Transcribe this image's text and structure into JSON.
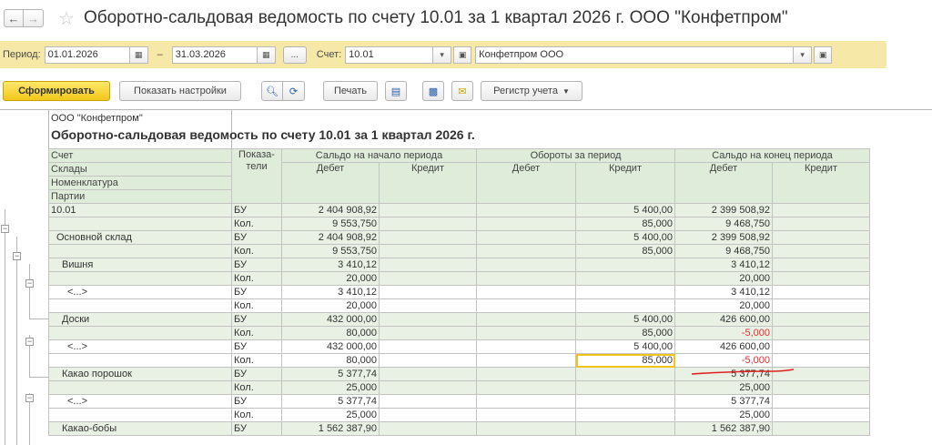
{
  "window": {
    "title": "Оборотно-сальдовая ведомость по счету 10.01 за 1 квартал 2026 г. ООО \"Конфетпром\"",
    "back_icon": "arrow-left-icon",
    "forward_icon": "arrow-right-icon",
    "favorite_icon": "star-icon"
  },
  "params": {
    "period_label": "Период:",
    "date_from": "01.01.2026",
    "dash": "–",
    "date_to": "31.03.2026",
    "more_label": "...",
    "account_label": "Счет:",
    "account_value": "10.01",
    "organization_value": "Конфетпром ООО"
  },
  "toolbar": {
    "generate_label": "Сформировать",
    "settings_label": "Показать настройки",
    "print_label": "Печать",
    "register_label": "Регистр учета"
  },
  "report": {
    "company": "ООО \"Конфетпром\"",
    "title": "Оборотно-сальдовая ведомость по счету 10.01 за 1 квартал 2026 г.",
    "headers": {
      "row_labels": [
        "Счет",
        "Склады",
        "Номенклатура",
        "Партии"
      ],
      "indicators": "Показа-\nтели",
      "opening": "Сальдо на начало периода",
      "turnover": "Обороты за период",
      "closing": "Сальдо на конец периода",
      "debit": "Дебет",
      "credit": "Кредит"
    },
    "rows": [
      {
        "name": "10.01",
        "bu": [
          "2 404 908,92",
          "",
          "",
          "5 400,00",
          "2 399 508,92",
          ""
        ],
        "kol": [
          "9 553,750",
          "",
          "",
          "85,000",
          "9 468,750",
          ""
        ]
      },
      {
        "name": "Основной склад",
        "bu": [
          "2 404 908,92",
          "",
          "",
          "5 400,00",
          "2 399 508,92",
          ""
        ],
        "kol": [
          "9 553,750",
          "",
          "",
          "85,000",
          "9 468,750",
          ""
        ]
      },
      {
        "name": "Вишня",
        "bu": [
          "3 410,12",
          "",
          "",
          "",
          "3 410,12",
          ""
        ],
        "kol": [
          "20,000",
          "",
          "",
          "",
          "20,000",
          ""
        ]
      },
      {
        "name": "<...>",
        "bu": [
          "3 410,12",
          "",
          "",
          "",
          "3 410,12",
          ""
        ],
        "kol": [
          "20,000",
          "",
          "",
          "",
          "20,000",
          ""
        ]
      },
      {
        "name": "Доски",
        "bu": [
          "432 000,00",
          "",
          "",
          "5 400,00",
          "426 600,00",
          ""
        ],
        "kol": [
          "80,000",
          "",
          "",
          "85,000",
          "-5,000",
          ""
        ]
      },
      {
        "name": "<...>",
        "bu": [
          "432 000,00",
          "",
          "",
          "5 400,00",
          "426 600,00",
          ""
        ],
        "kol": [
          "80,000",
          "",
          "",
          "85,000",
          "-5,000",
          ""
        ]
      },
      {
        "name": "Какао порошок",
        "bu": [
          "5 377,74",
          "",
          "",
          "",
          "5 377,74",
          ""
        ],
        "kol": [
          "25,000",
          "",
          "",
          "",
          "25,000",
          ""
        ]
      },
      {
        "name": "<...>",
        "bu": [
          "5 377,74",
          "",
          "",
          "",
          "5 377,74",
          ""
        ],
        "kol": [
          "25,000",
          "",
          "",
          "",
          "25,000",
          ""
        ]
      },
      {
        "name": "Какао-бобы",
        "bu": [
          "1 562 387,90",
          "",
          "",
          "",
          "1 562 387,90",
          ""
        ],
        "kol": []
      }
    ],
    "bu_label": "БУ",
    "kol_label": "Кол."
  },
  "colors": {
    "header_bg": "#dfecd9",
    "group_bg": "#e8f1e4",
    "negative": "#e03030",
    "accent_yellow": "#f2c71b",
    "period_bar": "#f6e8a6"
  }
}
